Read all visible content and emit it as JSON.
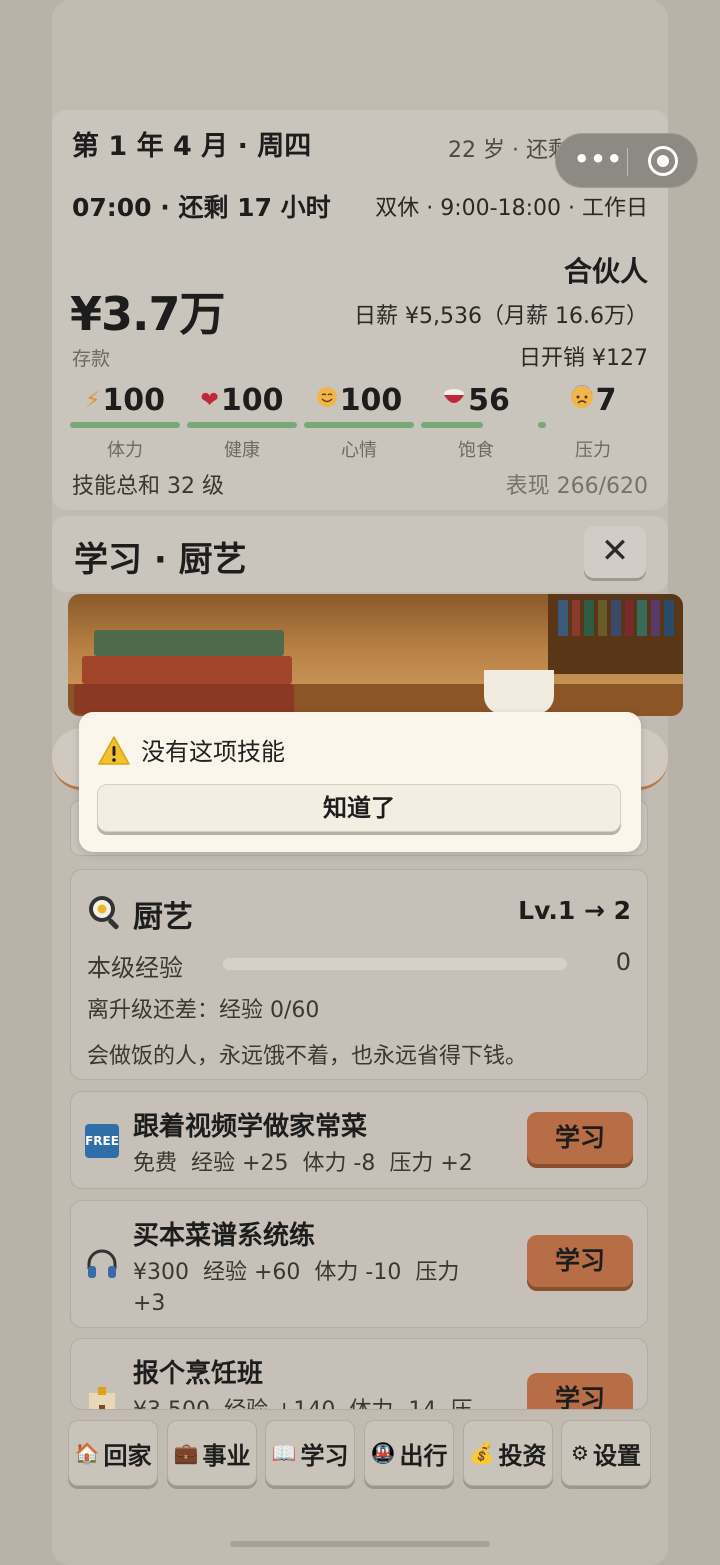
{
  "status": {
    "date": "第 1 年 4 月 · 周四",
    "age_left": "22 岁 · 还剩 235 天",
    "time": "07:00 · 还剩 17 小时",
    "schedule": "双休 · 9:00-18:00 · 工作日",
    "money": "¥3.7万",
    "savings_label": "存款",
    "role": "合伙人",
    "salary": "日薪 ¥5,536（月薪 16.6万）",
    "expense": "日开销 ¥127",
    "stats": [
      {
        "icon": "lightning-icon",
        "value": "100",
        "label": "体力",
        "level": 1.0
      },
      {
        "icon": "heart-icon",
        "value": "100",
        "label": "健康",
        "level": 1.0
      },
      {
        "icon": "smile-icon",
        "value": "100",
        "label": "心情",
        "level": 1.0
      },
      {
        "icon": "rice-bowl-icon",
        "value": "56",
        "label": "饱食",
        "level": 0.56
      },
      {
        "icon": "anxious-face-icon",
        "value": "7",
        "label": "压力",
        "level": 0.07
      }
    ],
    "skills_total": "技能总和 32 级",
    "performance": "表现 266/620"
  },
  "header": {
    "title": "学习 · 厨艺",
    "close": "✕"
  },
  "dialog": {
    "message": "没有这项技能",
    "button": "知道了"
  },
  "skill": {
    "icon": "frying-pan-icon",
    "name": "厨艺",
    "level": "Lv.1 → 2",
    "exp_label": "本级经验",
    "exp_value": "0",
    "exp_level": 0,
    "need": "离升级还差：经验 0/60",
    "desc": "会做饭的人，永远饿不着，也永远省得下钱。"
  },
  "options": [
    {
      "icon": "free-icon",
      "icon_text": "FREE",
      "title": "跟着视频学做家常菜",
      "details": [
        "免费",
        "经验 +25",
        "体力 -8",
        "压力 +2"
      ],
      "button": "学习"
    },
    {
      "icon": "headphones-icon",
      "title": "买本菜谱系统练",
      "details": [
        "¥300",
        "经验 +60",
        "体力 -10",
        "压力 +3"
      ],
      "button": "学习"
    },
    {
      "icon": "school-icon",
      "title": "报个烹饪班",
      "details": [
        "¥3,500",
        "经验 +140",
        "体力 -14",
        "压"
      ],
      "button": "学习"
    }
  ],
  "nav": [
    {
      "icon": "house-icon",
      "label": "回家"
    },
    {
      "icon": "briefcase-icon",
      "label": "事业"
    },
    {
      "icon": "book-icon",
      "label": "学习"
    },
    {
      "icon": "metro-icon",
      "label": "出行"
    },
    {
      "icon": "money-bag-icon",
      "label": "投资"
    },
    {
      "icon": "gear-icon",
      "label": "设置"
    }
  ],
  "colors": {
    "accent_button": "#b76e47",
    "stat_bar": "#79a878",
    "dialog_bg": "#fbf6ec"
  }
}
